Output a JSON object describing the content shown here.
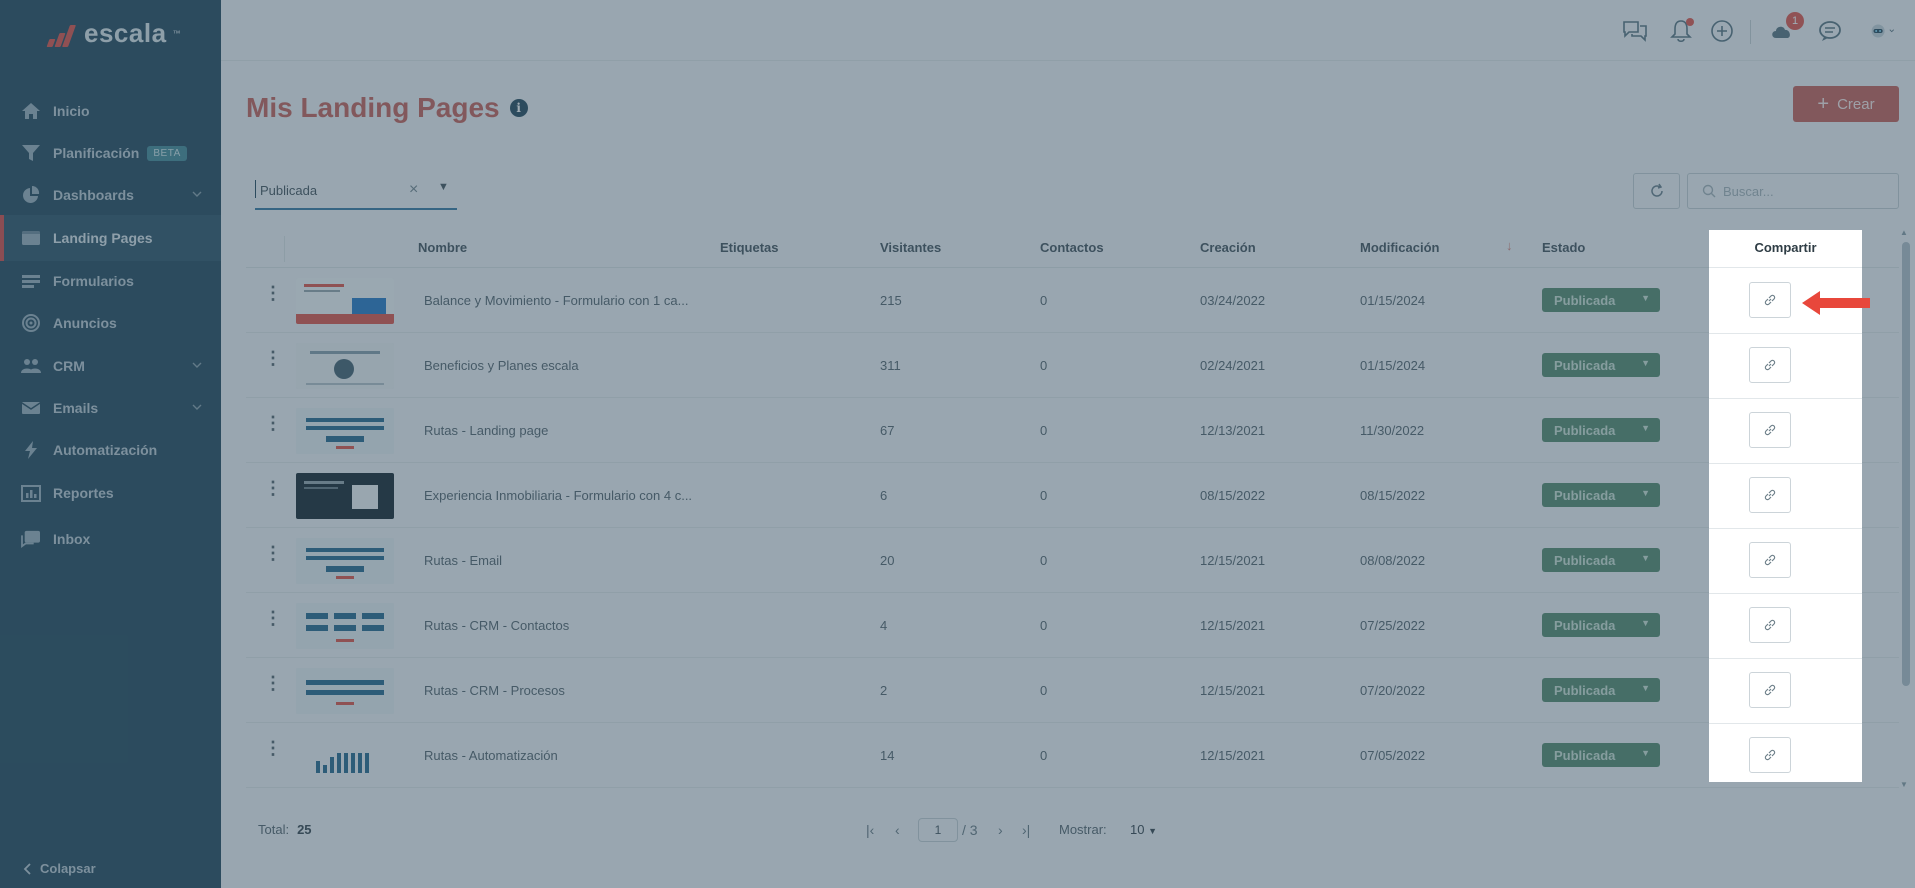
{
  "brand": {
    "name": "escala",
    "tm": "™",
    "accent": "#e0584f"
  },
  "sidebar": {
    "items": [
      {
        "label": "Inicio",
        "icon": "home-icon"
      },
      {
        "label": "Planificación",
        "icon": "funnel-icon",
        "badge": "BETA"
      },
      {
        "label": "Dashboards",
        "icon": "pie-chart-icon",
        "has_children": true
      },
      {
        "label": "Landing Pages",
        "icon": "window-icon",
        "active": true
      },
      {
        "label": "Formularios",
        "icon": "form-icon"
      },
      {
        "label": "Anuncios",
        "icon": "target-icon"
      },
      {
        "label": "CRM",
        "icon": "users-icon",
        "has_children": true
      },
      {
        "label": "Emails",
        "icon": "envelope-icon",
        "has_children": true
      },
      {
        "label": "Automatización",
        "icon": "bolt-icon"
      },
      {
        "label": "Reportes",
        "icon": "bar-report-icon"
      },
      {
        "label": "Inbox",
        "icon": "inbox-chat-icon"
      }
    ],
    "collapse_label": "Colapsar"
  },
  "topbar": {
    "icons": [
      "chat-bubbles-icon",
      "bell-icon",
      "plus-circle-icon",
      "cloud-icon",
      "support-chat-icon",
      "robot-avatar-icon"
    ],
    "cloud_badge": "1"
  },
  "page": {
    "title": "Mis Landing Pages",
    "create_label": "Crear"
  },
  "filter": {
    "value": "Publicada",
    "clear": "×"
  },
  "search": {
    "placeholder": "Buscar..."
  },
  "table": {
    "columns": [
      "Nombre",
      "Etiquetas",
      "Visitantes",
      "Contactos",
      "Creación",
      "Modificación",
      "Estado",
      "Compartir"
    ],
    "rows": [
      {
        "name": "Balance y Movimiento - Formulario con 1 ca...",
        "tags": "",
        "visitors": "215",
        "contacts": "0",
        "created": "03/24/2022",
        "modified": "01/15/2024",
        "status": "Publicada"
      },
      {
        "name": "Beneficios y Planes escala",
        "tags": "",
        "visitors": "311",
        "contacts": "0",
        "created": "02/24/2021",
        "modified": "01/15/2024",
        "status": "Publicada"
      },
      {
        "name": "Rutas - Landing page",
        "tags": "",
        "visitors": "67",
        "contacts": "0",
        "created": "12/13/2021",
        "modified": "11/30/2022",
        "status": "Publicada"
      },
      {
        "name": "Experiencia Inmobiliaria - Formulario con 4 c...",
        "tags": "",
        "visitors": "6",
        "contacts": "0",
        "created": "08/15/2022",
        "modified": "08/15/2022",
        "status": "Publicada"
      },
      {
        "name": "Rutas - Email",
        "tags": "",
        "visitors": "20",
        "contacts": "0",
        "created": "12/15/2021",
        "modified": "08/08/2022",
        "status": "Publicada"
      },
      {
        "name": "Rutas - CRM - Contactos",
        "tags": "",
        "visitors": "4",
        "contacts": "0",
        "created": "12/15/2021",
        "modified": "07/25/2022",
        "status": "Publicada"
      },
      {
        "name": "Rutas - CRM - Procesos",
        "tags": "",
        "visitors": "2",
        "contacts": "0",
        "created": "12/15/2021",
        "modified": "07/20/2022",
        "status": "Publicada"
      },
      {
        "name": "Rutas - Automatización",
        "tags": "",
        "visitors": "14",
        "contacts": "0",
        "created": "12/15/2021",
        "modified": "07/05/2022",
        "status": "Publicada"
      }
    ]
  },
  "footer": {
    "total_label": "Total:",
    "total_value": "25",
    "current_page": "1",
    "page_sep": "/ 3",
    "show_label": "Mostrar:",
    "show_value": "10"
  },
  "colors": {
    "sidebar_bg": "#2c4f63",
    "title": "#c9675f",
    "status_green": "#5c8f74",
    "highlight_arrow": "#e8473b"
  }
}
